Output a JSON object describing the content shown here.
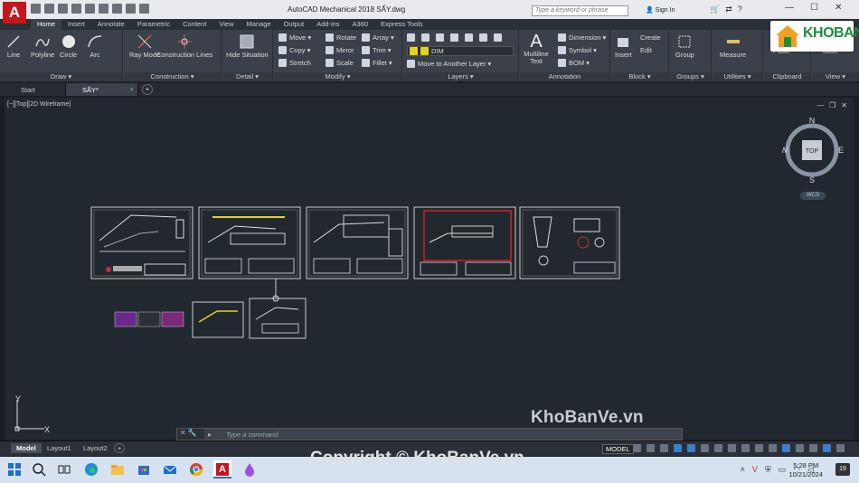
{
  "app": {
    "logo_letter": "A",
    "window_title": "AutoCAD Mechanical 2018    SẤY.dwg",
    "search_placeholder": "Type a keyword or phrase",
    "sign_in": "Sign In",
    "help_icons": [
      "cart-icon",
      "exchange-icon",
      "help-icon"
    ],
    "window_controls": [
      "minimize",
      "maximize",
      "close"
    ]
  },
  "ribbon_tabs": [
    "Home",
    "Insert",
    "Annotate",
    "Parametric",
    "Content",
    "View",
    "Manage",
    "Output",
    "Add-ins",
    "A360",
    "Express Tools"
  ],
  "ribbon_active_tab": "Home",
  "panels": {
    "draw": {
      "title": "Draw ▾",
      "tools": [
        "Line",
        "Polyline",
        "Circle",
        "Arc"
      ]
    },
    "construction": {
      "title": "Construction ▾",
      "tools": [
        "Ray Mode",
        "Construction Lines"
      ]
    },
    "detail": {
      "title": "Detail ▾",
      "tools": [
        "Hide Situation"
      ]
    },
    "modify": {
      "title": "Modify ▾",
      "rows": [
        [
          "Move ▾",
          "Rotate",
          "Array ▾"
        ],
        [
          "Copy ▾",
          "Mirror",
          "Trim ▾"
        ],
        [
          "Stretch",
          "Scale",
          "Fillet ▾"
        ]
      ]
    },
    "layers": {
      "title": "Layers ▾",
      "current_layer": "DIM",
      "move_layer": "Move to Another Layer ▾"
    },
    "annotation": {
      "title": "Annotation",
      "text_tool": "Multiline Text",
      "items": [
        "Dimension ▾",
        "Symbol ▾",
        "BOM ▾"
      ]
    },
    "block": {
      "title": "Block ▾",
      "tools": [
        "Insert",
        "Create",
        "Edit"
      ]
    },
    "groups": {
      "title": "Groups ▾",
      "tool": "Group"
    },
    "utilities": {
      "title": "Utilities ▾",
      "tool": "Measure"
    },
    "clipboard": {
      "title": "Clipboard",
      "tool": "Paste"
    },
    "view": {
      "title": "View ▾",
      "tool": "Base"
    }
  },
  "doc_tabs": [
    {
      "label": "Start",
      "active": false
    },
    {
      "label": "SẤY*",
      "active": true
    }
  ],
  "viewport": {
    "label": "[−][Top][2D Wireframe]",
    "viewcube": {
      "north": "N",
      "south": "S",
      "east": "E",
      "west": "W",
      "face": "TOP"
    },
    "wcs": "WCS",
    "ucs_x": "X",
    "ucs_y": "Y"
  },
  "command_line": {
    "prompt": "Type a command"
  },
  "layout_tabs": [
    "Model",
    "Layout1",
    "Layout2"
  ],
  "layout_active": "Model",
  "status": {
    "mode": "MODEL"
  },
  "watermarks": {
    "logo_text": "KHOBANVE",
    "mid_text": "KhoBanVe.vn",
    "copyright": "Copyright © KhoBanVe.vn"
  },
  "taskbar": {
    "apps": [
      "windows-start",
      "search",
      "task-view",
      "edge",
      "file-explorer",
      "store",
      "mail",
      "chrome",
      "autocad",
      "paint"
    ],
    "time": "5:28 PM",
    "date": "10/21/2024",
    "notification_count": "19"
  },
  "colors": {
    "accent_red": "#c4161c",
    "canvas": "#212830",
    "ribbon": "#3b414a",
    "brand_green": "#1b8e3c",
    "layer_yellow": "#e6d21a"
  }
}
